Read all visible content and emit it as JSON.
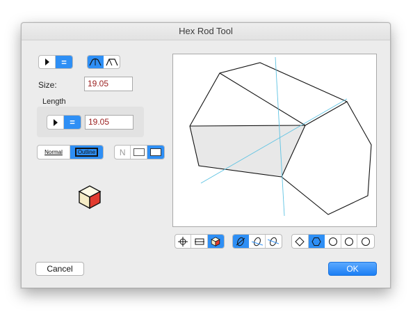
{
  "window": {
    "title": "Hex Rod Tool"
  },
  "fields": {
    "size_label": "Size:",
    "size_value": "19.05",
    "length_label": "Length",
    "length_value": "19.05"
  },
  "style_toggle": {
    "normal": "Normal",
    "outline": "Outline"
  },
  "fill_toggle": {
    "none": "N"
  },
  "buttons": {
    "cancel": "Cancel",
    "ok": "OK"
  },
  "colors": {
    "accent": "#2e8ff5",
    "value_text": "#9b2020",
    "guide_line": "#5ec3e3",
    "cube_red": "#e23b2f"
  }
}
